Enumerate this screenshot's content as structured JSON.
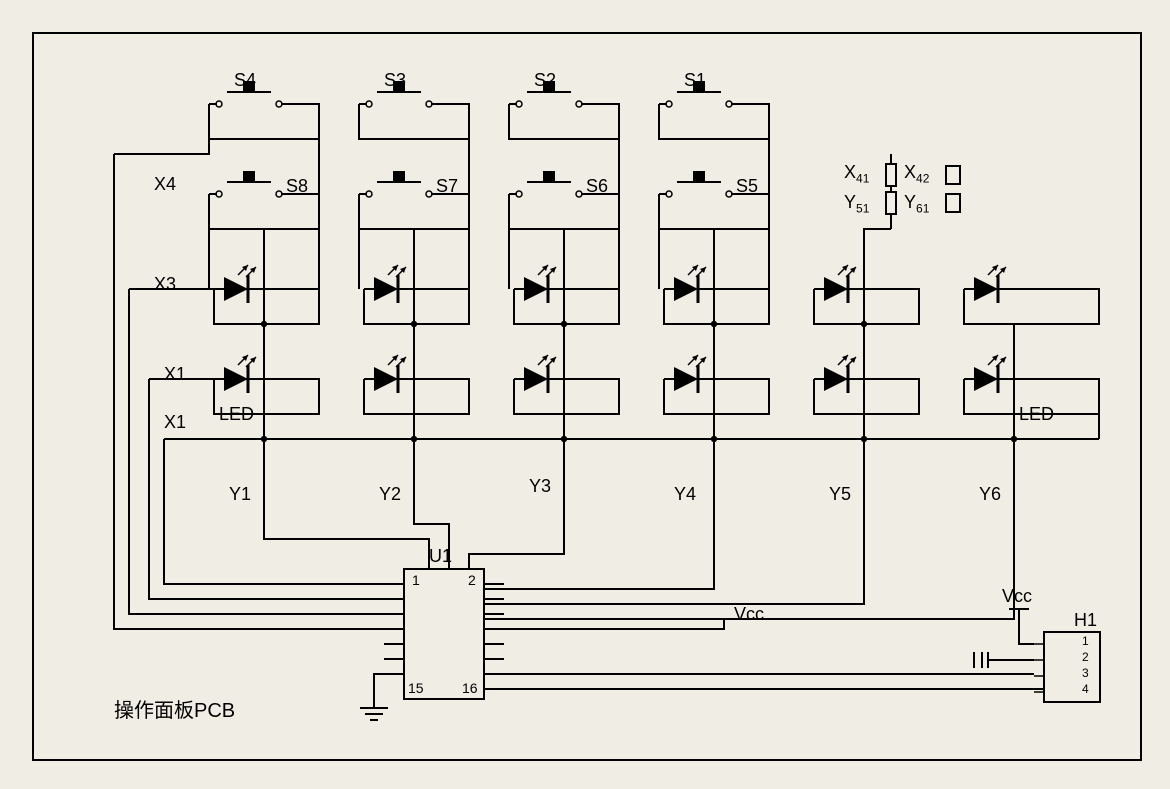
{
  "title": "操作面板PCB",
  "switches_top": {
    "s4": "S4",
    "s3": "S3",
    "s2": "S2",
    "s1": "S1"
  },
  "switches_bottom": {
    "s8": "S8",
    "s7": "S7",
    "s6": "S6",
    "s5": "S5"
  },
  "row_labels": {
    "x4": "X4",
    "x3": "X3",
    "x1a": "X1",
    "x1b": "X1"
  },
  "col_labels": {
    "y1": "Y1",
    "y2": "Y2",
    "y3": "Y3",
    "y4": "Y4",
    "y5": "Y5",
    "y6": "Y6"
  },
  "led_label_left": "LED",
  "led_label_right": "LED",
  "ic": {
    "ref": "U1",
    "pin_tl": "1",
    "pin_tr": "2",
    "pin_bl": "15",
    "pin_br": "16"
  },
  "vcc_mid": "Vcc",
  "connector": {
    "ref": "H1",
    "vcc": "Vcc",
    "pin1": "1",
    "pin2": "2",
    "pin3": "3",
    "pin4": "4"
  },
  "right_top": {
    "x41": "X",
    "x41_sub": "41",
    "x42": "X",
    "x42_sub": "42",
    "y51": "Y",
    "y51_sub": "51",
    "y61": "Y",
    "y61_sub": "61"
  },
  "chart_data": {
    "type": "table",
    "description": "Circuit schematic: 4 row lines (X1..X4) and 6 column lines (Y1..Y6) matrix with 8 pushbutton switches S1..S8 on rows X4/X3 (cols Y1..Y4), 12 LEDs on rows X3/X1 (cols Y1..Y6), a 16-pin IC U1, Vcc rail, ground, and 4-pin connector H1.",
    "switches": [
      {
        "ref": "S1",
        "row": "top",
        "col": 4
      },
      {
        "ref": "S2",
        "row": "top",
        "col": 3
      },
      {
        "ref": "S3",
        "row": "top",
        "col": 2
      },
      {
        "ref": "S4",
        "row": "top",
        "col": 1
      },
      {
        "ref": "S5",
        "row": "bottom",
        "col": 4
      },
      {
        "ref": "S6",
        "row": "bottom",
        "col": 3
      },
      {
        "ref": "S7",
        "row": "bottom",
        "col": 2
      },
      {
        "ref": "S8",
        "row": "bottom",
        "col": 1
      }
    ],
    "leds": {
      "rows": [
        "X3",
        "X1"
      ],
      "cols": [
        "Y1",
        "Y2",
        "Y3",
        "Y4",
        "Y5",
        "Y6"
      ],
      "count": 12
    },
    "ic": "U1",
    "connector": "H1"
  }
}
